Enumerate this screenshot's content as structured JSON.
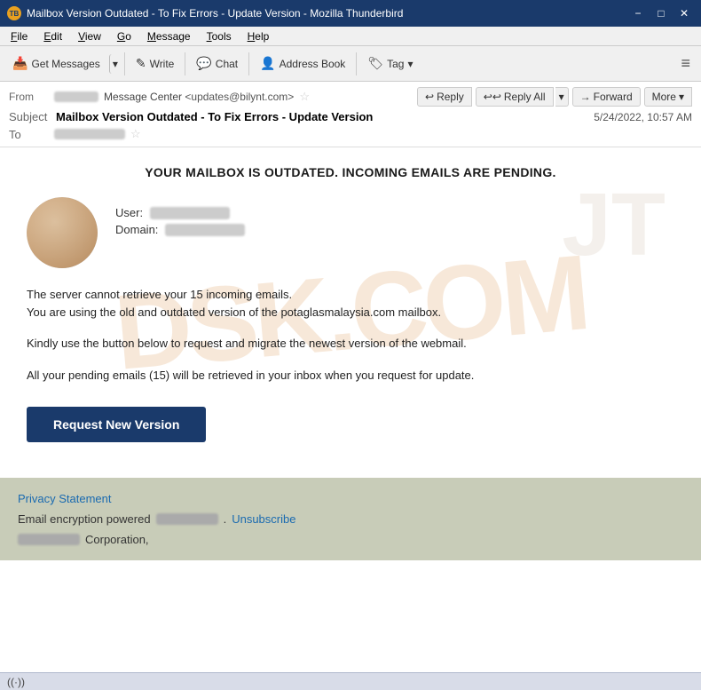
{
  "titleBar": {
    "title": "Mailbox Version Outdated - To Fix Errors - Update Version - Mozilla Thunderbird",
    "appIcon": "TB",
    "controls": {
      "minimize": "−",
      "maximize": "□",
      "close": "✕"
    }
  },
  "menuBar": {
    "items": [
      {
        "label": "File",
        "underline": "F"
      },
      {
        "label": "Edit",
        "underline": "E"
      },
      {
        "label": "View",
        "underline": "V"
      },
      {
        "label": "Go",
        "underline": "G"
      },
      {
        "label": "Message",
        "underline": "M"
      },
      {
        "label": "Tools",
        "underline": "T"
      },
      {
        "label": "Help",
        "underline": "H"
      }
    ]
  },
  "toolbar": {
    "getMessages": "Get Messages",
    "write": "Write",
    "chat": "Chat",
    "addressBook": "Address Book",
    "tag": "Tag",
    "menuIcon": "≡"
  },
  "emailHeader": {
    "fromLabel": "From",
    "fromName": "Message Center",
    "fromEmail": "<updates@bilynt.com>",
    "subjectLabel": "Subject",
    "subject": "Mailbox Version Outdated - To Fix Errors - Update Version",
    "date": "5/24/2022, 10:57 AM",
    "toLabel": "To",
    "actions": {
      "reply": "Reply",
      "replyAll": "Reply All",
      "forward": "Forward",
      "more": "More"
    }
  },
  "emailBody": {
    "headline": "YOUR MAILBOX IS OUTDATED. INCOMING EMAILS ARE PENDING.",
    "userLabel": "User:",
    "domainLabel": "Domain:",
    "para1": "The server cannot retrieve your 15 incoming emails.",
    "para2": "You are using the old and outdated version of the potaglasmalaysia.com mailbox.",
    "para3": "Kindly use the button below to request and migrate the newest version of the webmail.",
    "para4": "All your pending emails (15) will be retrieved in your inbox when you request for update.",
    "requestBtn": "Request New Version",
    "watermark": "DSK.COM"
  },
  "footer": {
    "privacyLink": "Privacy Statement",
    "encryptionText": "Email encryption powered",
    "unsubscribeLink": "Unsubscribe",
    "corporationText": "Corporation,"
  },
  "statusBar": {
    "wifiSymbol": "((·))"
  }
}
